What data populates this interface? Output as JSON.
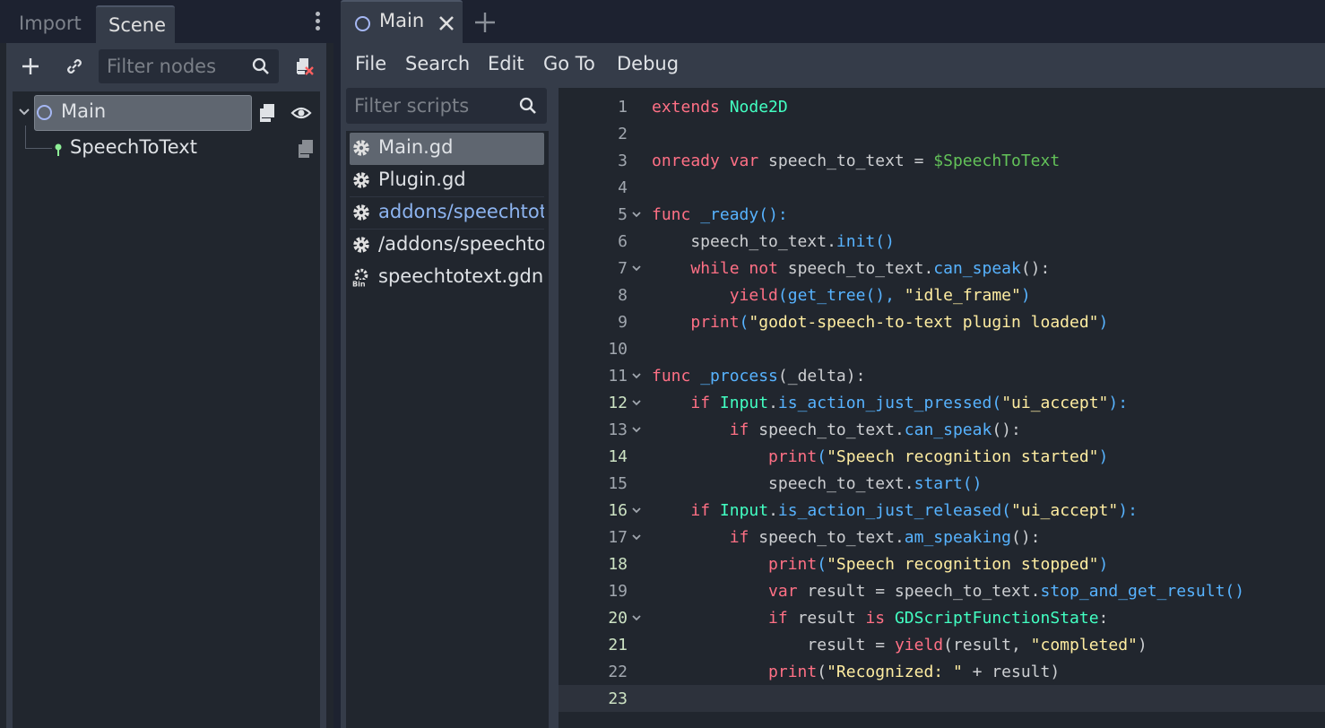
{
  "dock": {
    "tab_import": "Import",
    "tab_scene": "Scene",
    "filter_nodes_placeholder": "Filter nodes"
  },
  "scene_tree": {
    "root": "Main",
    "child": "SpeechToText"
  },
  "editor": {
    "tab_title": "Main",
    "menu": {
      "file": "File",
      "search": "Search",
      "edit": "Edit",
      "goto": "Go To",
      "debug": "Debug"
    },
    "filter_scripts_placeholder": "Filter scripts",
    "scripts": [
      "Main.gd",
      "Plugin.gd",
      "addons/speechtote",
      "/addons/speechtot",
      "speechtotext.gdns"
    ]
  },
  "code": {
    "line_numbers": [
      "1",
      "2",
      "3",
      "4",
      "5",
      "6",
      "7",
      "8",
      "9",
      "10",
      "11",
      "12",
      "13",
      "14",
      "15",
      "16",
      "17",
      "18",
      "19",
      "20",
      "21",
      "22",
      "23"
    ],
    "tokens": {
      "l1": [
        "extends",
        " ",
        "Node2D"
      ],
      "l3": [
        "onready",
        " ",
        "var",
        " speech_to_text = ",
        "$SpeechToText"
      ],
      "l5": [
        "func",
        " ",
        "_ready",
        "():"
      ],
      "l6": [
        "    speech_to_text.",
        "init",
        "()"
      ],
      "l7": [
        "    ",
        "while",
        " ",
        "not",
        " speech_to_text.",
        "can_speak",
        "():"
      ],
      "l8": [
        "        ",
        "yield",
        "(",
        "get_tree",
        "(), ",
        "\"idle_frame\"",
        ")"
      ],
      "l9": [
        "    ",
        "print",
        "(",
        "\"godot-speech-to-text plugin loaded\"",
        ")"
      ],
      "l11": [
        "func",
        " ",
        "_process",
        "(_delta):"
      ],
      "l12": [
        "    ",
        "if",
        " ",
        "Input",
        ".",
        "is_action_just_pressed",
        "(",
        "\"ui_accept\"",
        "):"
      ],
      "l13": [
        "        ",
        "if",
        " speech_to_text.",
        "can_speak",
        "():"
      ],
      "l14": [
        "            ",
        "print",
        "(",
        "\"Speech recognition started\"",
        ")"
      ],
      "l15": [
        "            speech_to_text.",
        "start",
        "()"
      ],
      "l16": [
        "    ",
        "if",
        " ",
        "Input",
        ".",
        "is_action_just_released",
        "(",
        "\"ui_accept\"",
        "):"
      ],
      "l17": [
        "        ",
        "if",
        " speech_to_text.",
        "am_speaking",
        "():"
      ],
      "l18": [
        "            ",
        "print",
        "(",
        "\"Speech recognition stopped\"",
        ")"
      ],
      "l19": [
        "            ",
        "var",
        " result = speech_to_text.",
        "stop_and_get_result",
        "()"
      ],
      "l20": [
        "            ",
        "if",
        " result ",
        "is",
        " ",
        "GDScriptFunctionState",
        ":"
      ],
      "l21": [
        "                result = ",
        "yield",
        "(result, ",
        "\"completed\"",
        ")"
      ],
      "l22": [
        "            ",
        "print",
        "(",
        "\"Recognized: \"",
        " + result)"
      ]
    }
  }
}
